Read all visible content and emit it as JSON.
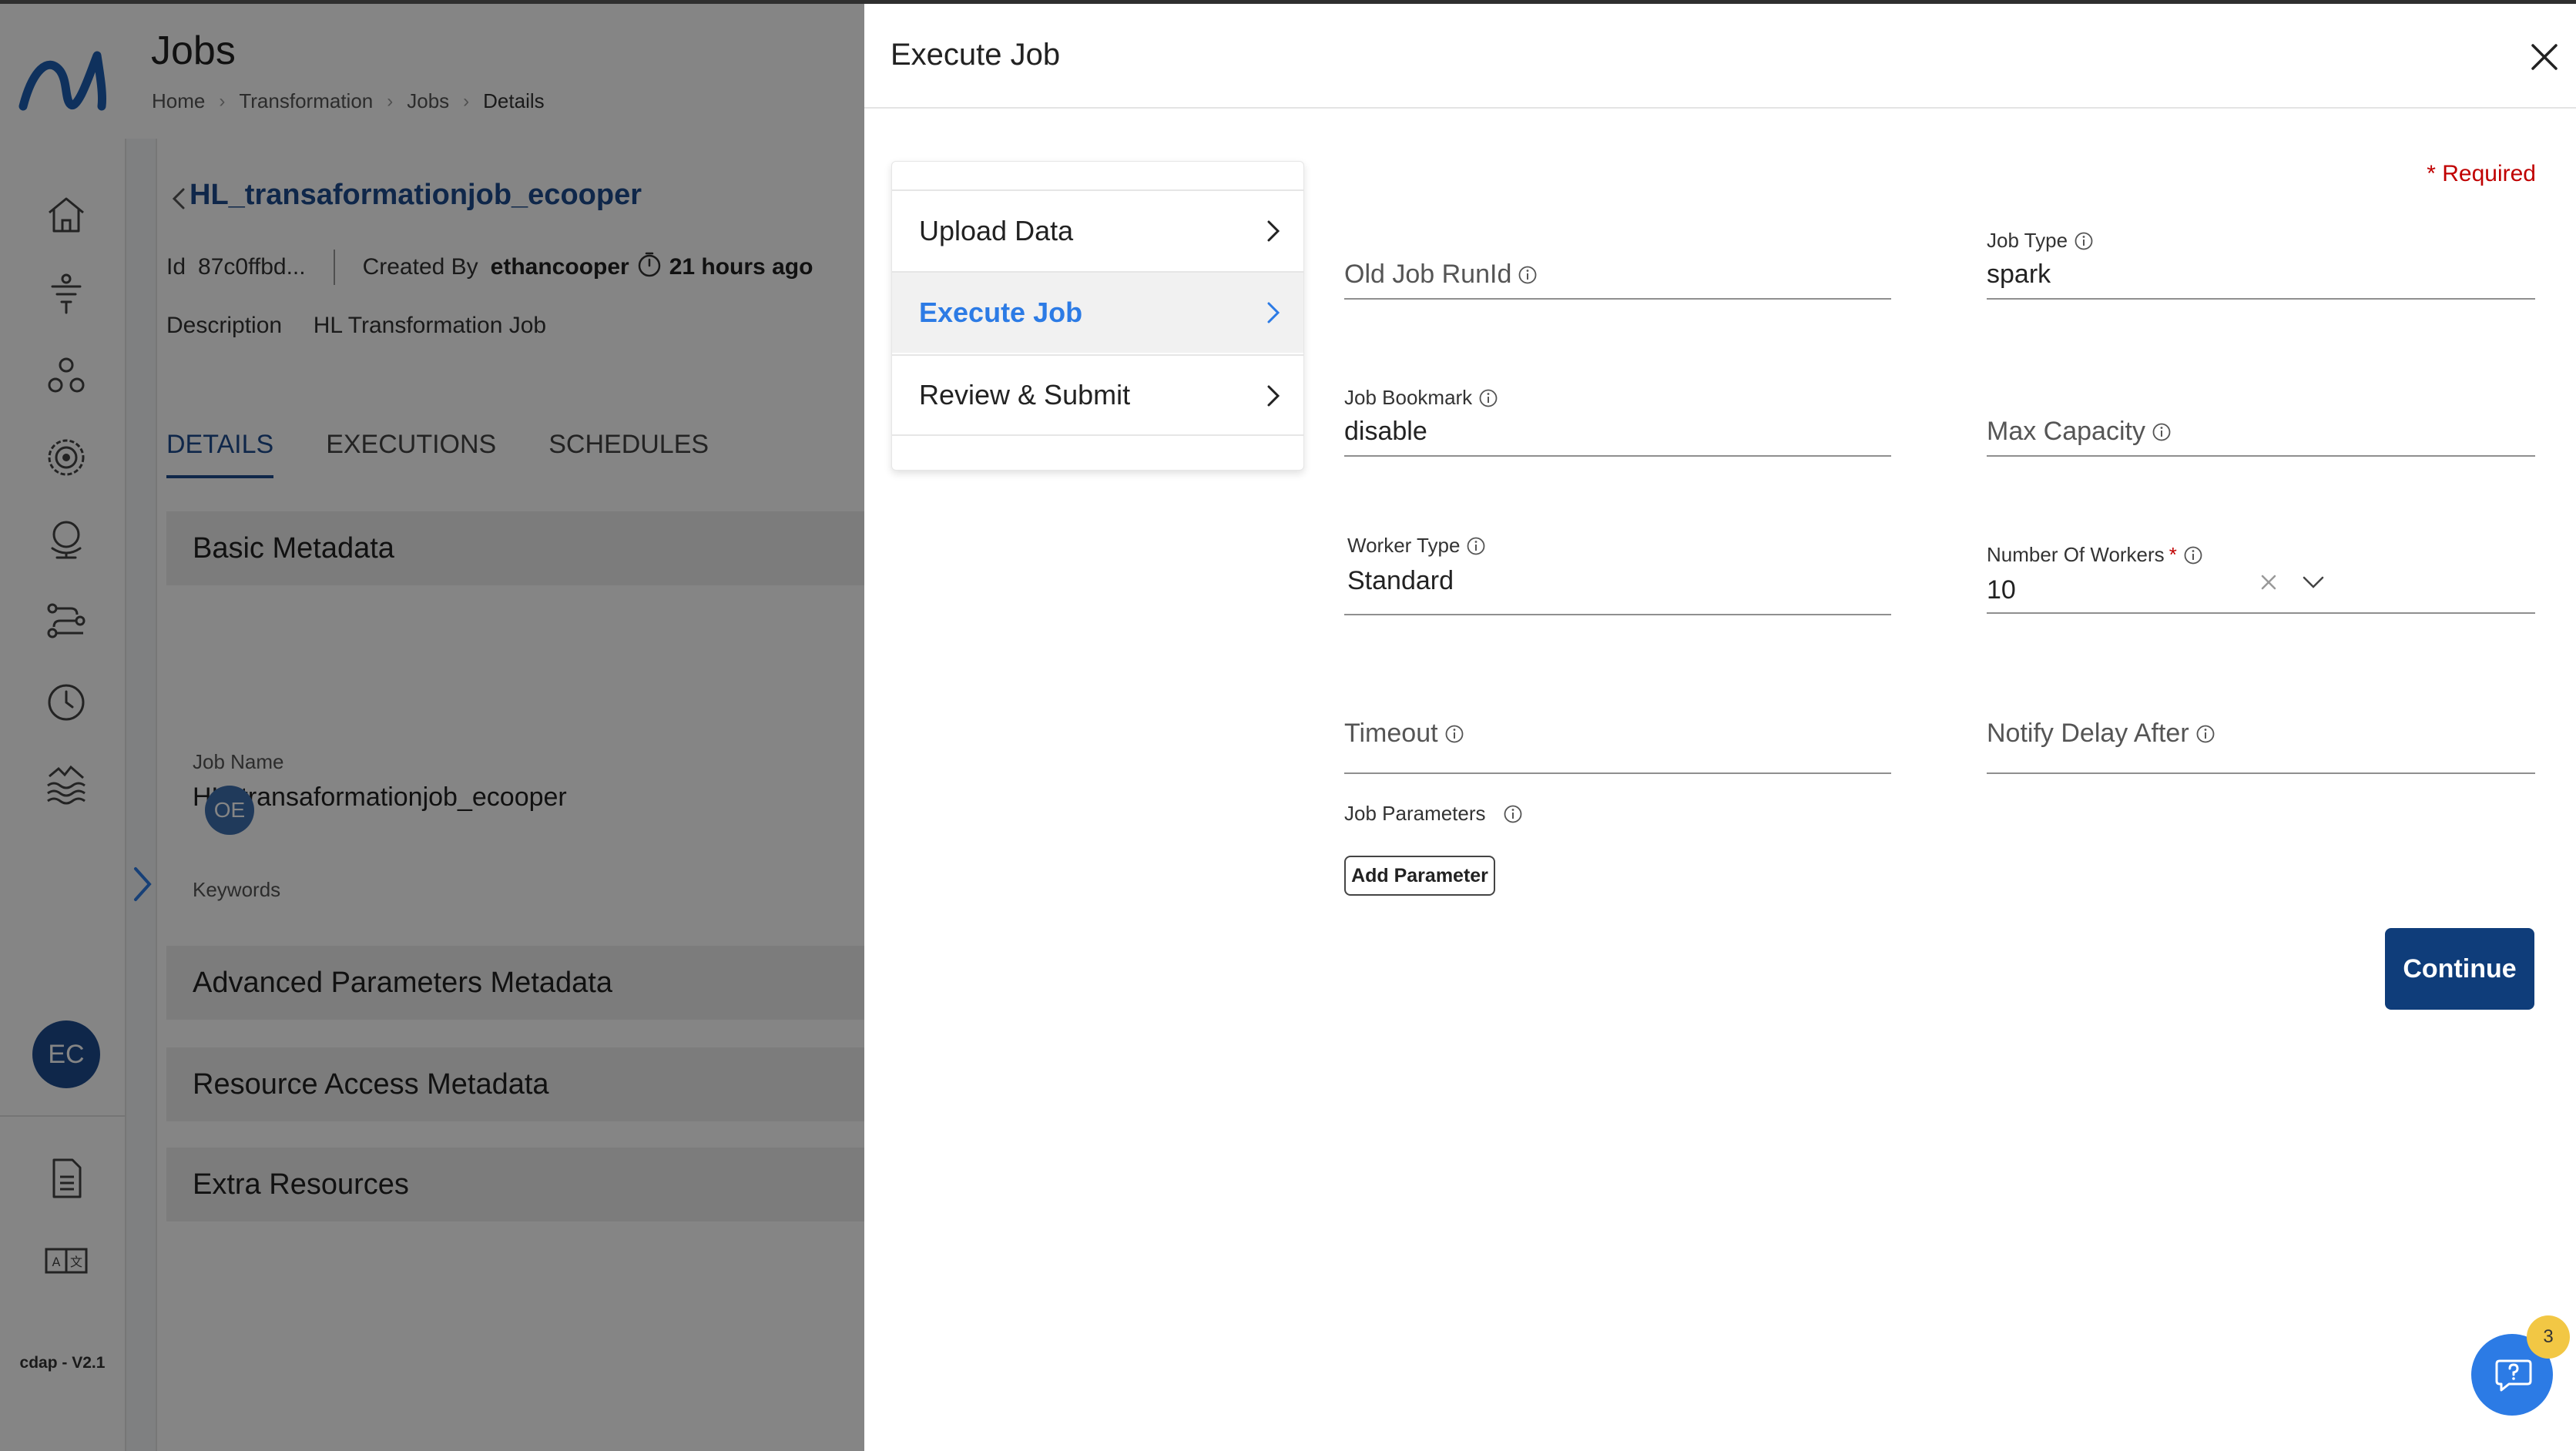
{
  "app": {
    "version": "cdap - V2.1",
    "user_initials": "EC",
    "page_title": "Jobs",
    "breadcrumb": [
      "Home",
      "Transformation",
      "Jobs",
      "Details"
    ]
  },
  "job": {
    "name": "HL_transaformationjob_ecooper",
    "id_label": "Id",
    "id_value": "87c0ffbd...",
    "created_by_label": "Created By",
    "created_by": "ethancooper",
    "created_ago": "21 hours ago",
    "description_label": "Description",
    "description": "HL Transformation Job"
  },
  "tabs": [
    "DETAILS",
    "EXECUTIONS",
    "SCHEDULES"
  ],
  "sections": {
    "basic": "Basic Metadata",
    "job_name_label": "Job Name",
    "job_name_value": "HL_transaformationjob_ecooper",
    "keywords_label": "Keywords",
    "keyword_chip": "OE",
    "advanced": "Advanced Parameters Metadata",
    "resource": "Resource Access Metadata",
    "extra": "Extra Resources"
  },
  "drawer": {
    "title": "Execute Job",
    "required_note": "* Required",
    "steps": [
      "Upload Data",
      "Execute Job",
      "Review & Submit"
    ],
    "fields": {
      "old_job_run_id": {
        "placeholder": "Old Job RunId"
      },
      "job_type": {
        "label": "Job Type",
        "value": "spark"
      },
      "job_bookmark": {
        "label": "Job Bookmark",
        "value": "disable"
      },
      "max_capacity": {
        "placeholder": "Max Capacity"
      },
      "worker_type": {
        "label": "Worker Type",
        "value": "Standard"
      },
      "number_of_workers": {
        "label": "Number Of Workers",
        "required_mark": "*",
        "value": "10"
      },
      "timeout": {
        "placeholder": "Timeout"
      },
      "notify_delay_after": {
        "placeholder": "Notify Delay After"
      },
      "job_parameters": {
        "label": "Job Parameters"
      }
    },
    "add_parameter_label": "Add Parameter",
    "continue_label": "Continue"
  },
  "help": {
    "badge_count": "3"
  },
  "colors": {
    "brand_blue": "#1e4c8f",
    "active_step_blue": "#2c7be5",
    "primary_button": "#0f3d7a",
    "required_red": "#c00000",
    "badge_yellow": "#f2c744"
  }
}
